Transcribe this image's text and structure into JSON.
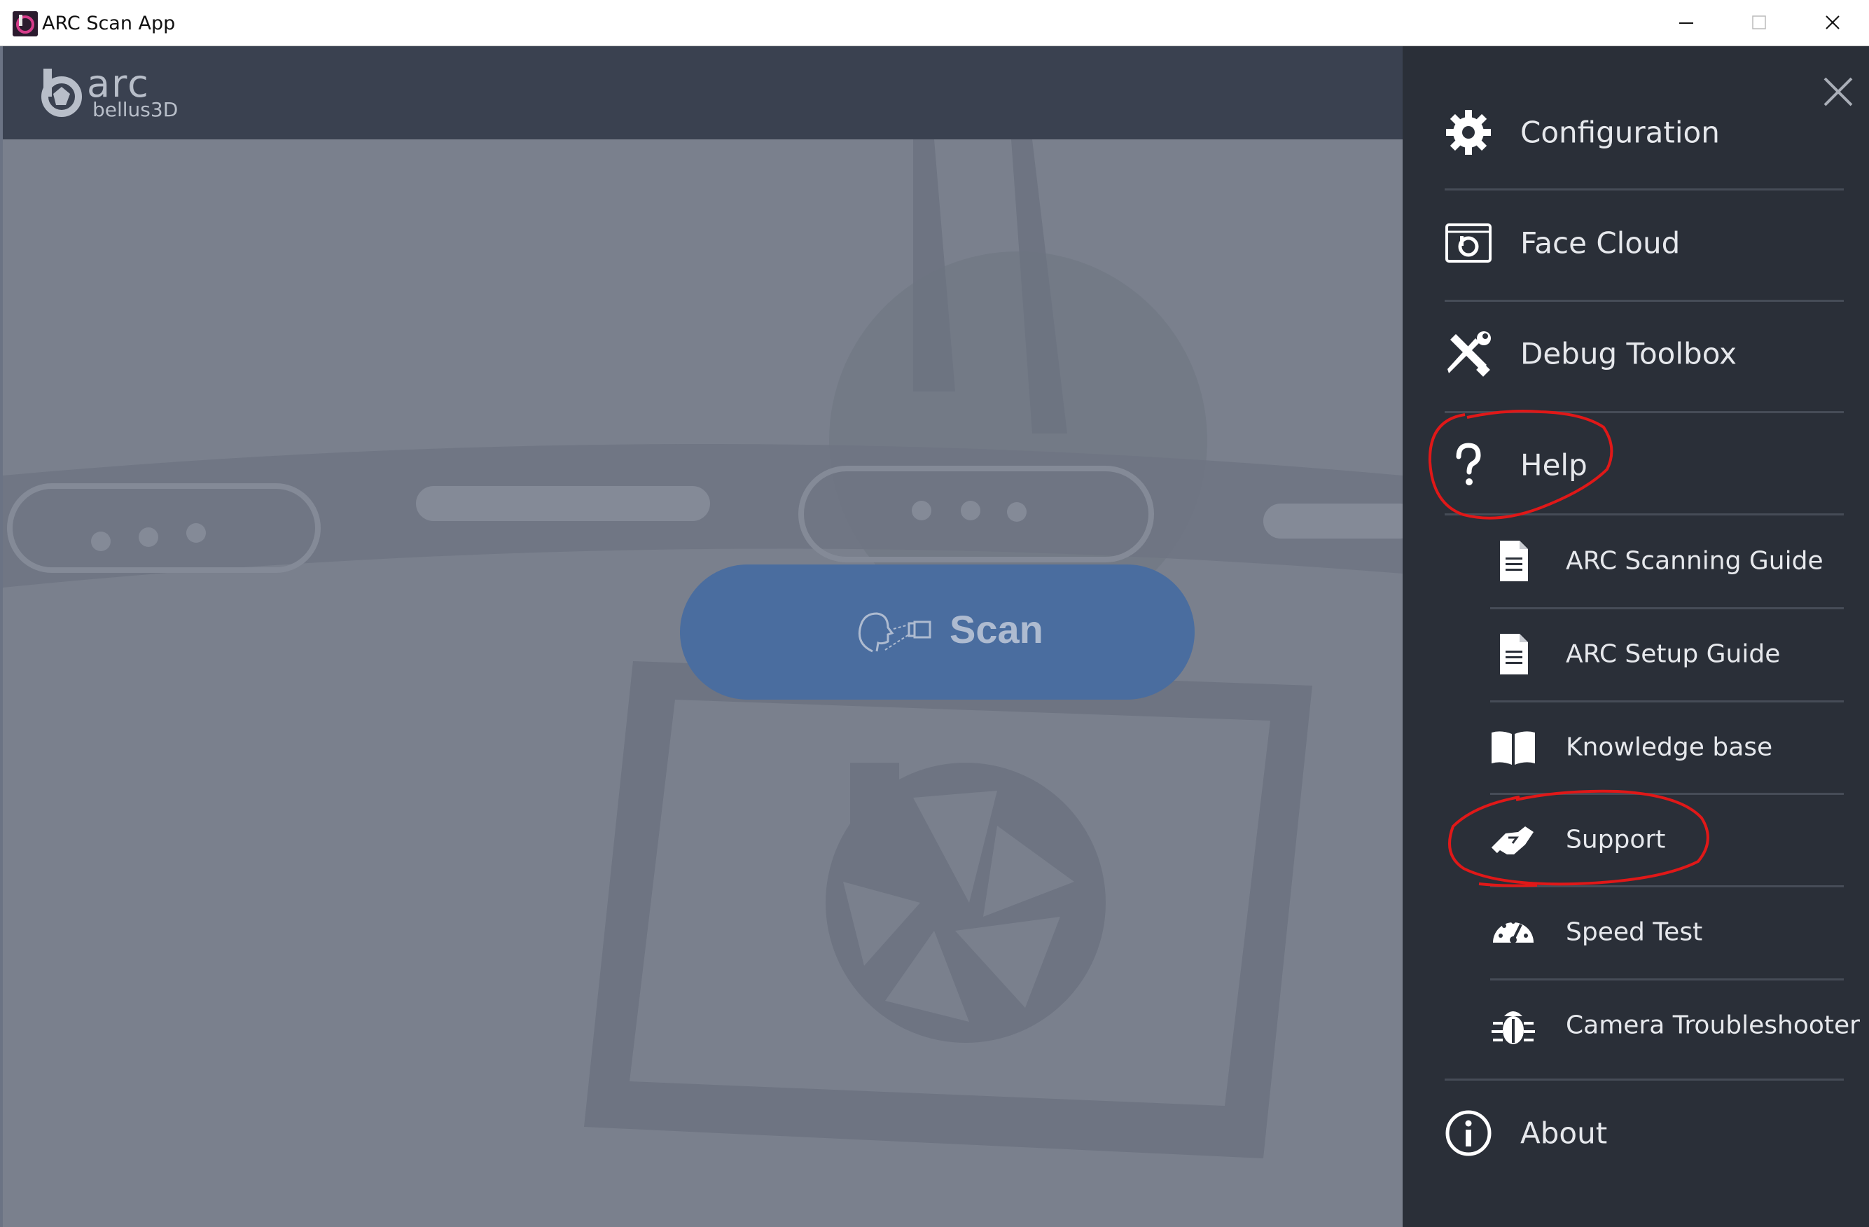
{
  "window": {
    "title": "ARC Scan App"
  },
  "header": {
    "logo_word": "arc",
    "logo_sub": "bellus3D"
  },
  "main": {
    "scan_label": "Scan"
  },
  "menu": {
    "items": [
      {
        "label": "Configuration",
        "icon": "gear-icon"
      },
      {
        "label": "Face Cloud",
        "icon": "face-cloud-icon"
      },
      {
        "label": "Debug Toolbox",
        "icon": "tools-icon"
      },
      {
        "label": "Help",
        "icon": "question-icon"
      }
    ],
    "help_items": [
      {
        "label": "ARC Scanning Guide",
        "icon": "document-icon"
      },
      {
        "label": "ARC Setup Guide",
        "icon": "document-icon"
      },
      {
        "label": "Knowledge base",
        "icon": "book-icon"
      },
      {
        "label": "Support",
        "icon": "handshake-icon"
      },
      {
        "label": "Speed Test",
        "icon": "speedometer-icon"
      },
      {
        "label": "Camera Troubleshooter",
        "icon": "bug-icon"
      }
    ],
    "about_label": "About",
    "about_icon": "info-icon"
  },
  "colors": {
    "menu_bg": "#2a2f38",
    "header_bg": "#3a4150",
    "scan_button": "#4a6d9f",
    "annotation": "#e01818"
  }
}
